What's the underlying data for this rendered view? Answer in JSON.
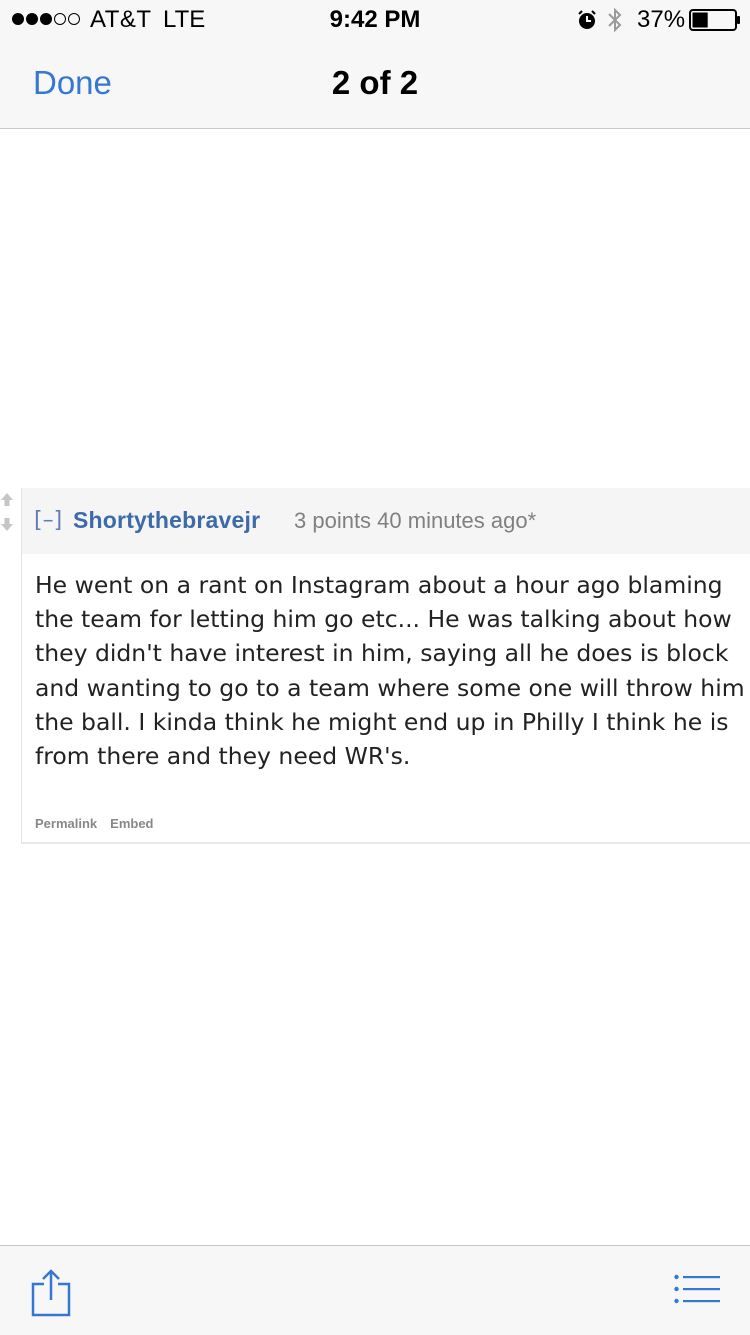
{
  "status_bar": {
    "carrier": "AT&T",
    "network": "LTE",
    "time": "9:42 PM",
    "battery_percent": "37%",
    "battery_level": 0.37,
    "signal_bars_filled": 3,
    "signal_bars_total": 5
  },
  "nav": {
    "done_label": "Done",
    "title": "2 of 2"
  },
  "comment": {
    "collapse_label": "[–]",
    "author": "Shortythebravejr",
    "meta": "3 points 40 minutes ago*",
    "body": "He went on a rant on Instagram about a hour ago blaming the team for letting him go etc... He was talking about how they didn't have interest in him, saying all he does is block and wanting to go to a team where some one will throw him the ball. I kinda think he might end up in Philly I think he is from there and they need WR's.",
    "actions": {
      "permalink": "Permalink",
      "embed": "Embed"
    }
  },
  "colors": {
    "accent": "#3478d4",
    "author_link": "#3d6aa8",
    "meta_gray": "#808080"
  },
  "icons": {
    "alarm": "alarm-clock-icon",
    "bluetooth": "bluetooth-icon",
    "battery": "battery-icon",
    "vote": "vote-arrows-icon",
    "share": "share-icon",
    "list": "list-icon"
  }
}
